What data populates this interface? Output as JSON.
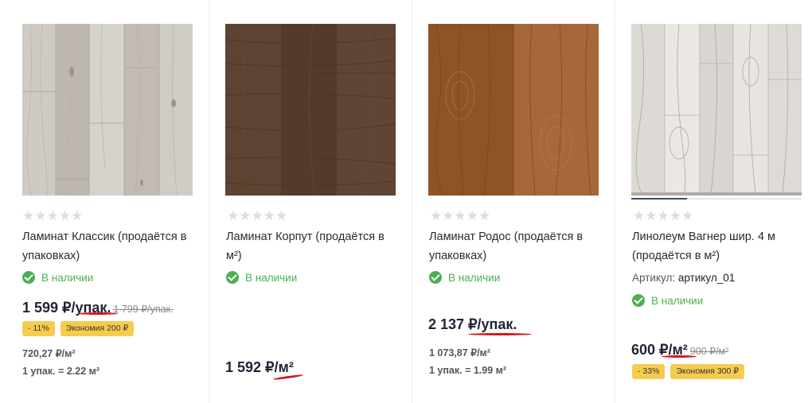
{
  "colors": {
    "in_stock": "#4caf50",
    "badge": "#f6cc4f",
    "price": "#1f2433",
    "red_mark": "#d8151b"
  },
  "products": [
    {
      "image_icon": "light-wood-laminate-image",
      "rating_stars": "★★★★★",
      "title": "Ламинат Классик (продаётся в упаковках)",
      "stock": "В наличии",
      "price": "1 599 ₽/упак.",
      "old_price": "1 799 ₽/упак.",
      "discount": "- 11%",
      "economy": "Экономия 200 ₽",
      "per_m2": "720,27 ₽/м²",
      "pack_area": "1 упак. = 2.22 м²"
    },
    {
      "image_icon": "dark-wood-laminate-image",
      "rating_stars": "★★★★★",
      "title": "Ламинат Корпут (продаётся в м²)",
      "stock": "В наличии",
      "price": "1 592 ₽/м²"
    },
    {
      "image_icon": "oak-wood-laminate-image",
      "rating_stars": "★★★★★",
      "title": "Ламинат Родос (продаётся в упаковках)",
      "stock": "В наличии",
      "price": "2 137 ₽/упак.",
      "per_m2": "1 073,87 ₽/м²",
      "pack_area": "1 упак. = 1.99 м²"
    },
    {
      "image_icon": "whitewashed-wood-linoleum-image",
      "rating_stars": "★★★★★",
      "title": "Линолеум Вагнер шир. 4 м (продаётся в м²)",
      "article_label": "Артикул:",
      "article_value": "артикул_01",
      "stock": "В наличии",
      "price": "600 ₽/м²",
      "old_price": "900 ₽/м²",
      "discount": "- 33%",
      "economy": "Экономия 300 ₽"
    }
  ]
}
